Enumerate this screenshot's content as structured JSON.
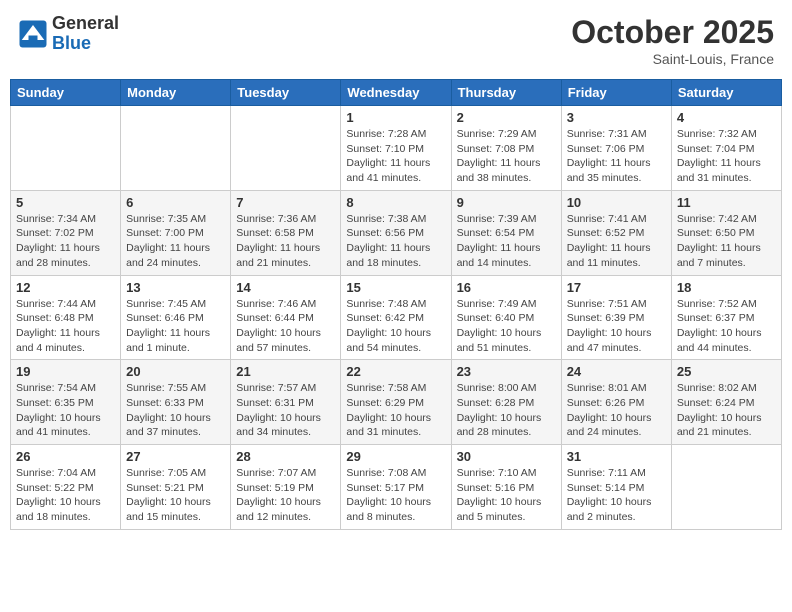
{
  "header": {
    "logo_general": "General",
    "logo_blue": "Blue",
    "month_title": "October 2025",
    "location": "Saint-Louis, France"
  },
  "days_of_week": [
    "Sunday",
    "Monday",
    "Tuesday",
    "Wednesday",
    "Thursday",
    "Friday",
    "Saturday"
  ],
  "weeks": [
    [
      {
        "day": "",
        "info": ""
      },
      {
        "day": "",
        "info": ""
      },
      {
        "day": "",
        "info": ""
      },
      {
        "day": "1",
        "info": "Sunrise: 7:28 AM\nSunset: 7:10 PM\nDaylight: 11 hours and 41 minutes."
      },
      {
        "day": "2",
        "info": "Sunrise: 7:29 AM\nSunset: 7:08 PM\nDaylight: 11 hours and 38 minutes."
      },
      {
        "day": "3",
        "info": "Sunrise: 7:31 AM\nSunset: 7:06 PM\nDaylight: 11 hours and 35 minutes."
      },
      {
        "day": "4",
        "info": "Sunrise: 7:32 AM\nSunset: 7:04 PM\nDaylight: 11 hours and 31 minutes."
      }
    ],
    [
      {
        "day": "5",
        "info": "Sunrise: 7:34 AM\nSunset: 7:02 PM\nDaylight: 11 hours and 28 minutes."
      },
      {
        "day": "6",
        "info": "Sunrise: 7:35 AM\nSunset: 7:00 PM\nDaylight: 11 hours and 24 minutes."
      },
      {
        "day": "7",
        "info": "Sunrise: 7:36 AM\nSunset: 6:58 PM\nDaylight: 11 hours and 21 minutes."
      },
      {
        "day": "8",
        "info": "Sunrise: 7:38 AM\nSunset: 6:56 PM\nDaylight: 11 hours and 18 minutes."
      },
      {
        "day": "9",
        "info": "Sunrise: 7:39 AM\nSunset: 6:54 PM\nDaylight: 11 hours and 14 minutes."
      },
      {
        "day": "10",
        "info": "Sunrise: 7:41 AM\nSunset: 6:52 PM\nDaylight: 11 hours and 11 minutes."
      },
      {
        "day": "11",
        "info": "Sunrise: 7:42 AM\nSunset: 6:50 PM\nDaylight: 11 hours and 7 minutes."
      }
    ],
    [
      {
        "day": "12",
        "info": "Sunrise: 7:44 AM\nSunset: 6:48 PM\nDaylight: 11 hours and 4 minutes."
      },
      {
        "day": "13",
        "info": "Sunrise: 7:45 AM\nSunset: 6:46 PM\nDaylight: 11 hours and 1 minute."
      },
      {
        "day": "14",
        "info": "Sunrise: 7:46 AM\nSunset: 6:44 PM\nDaylight: 10 hours and 57 minutes."
      },
      {
        "day": "15",
        "info": "Sunrise: 7:48 AM\nSunset: 6:42 PM\nDaylight: 10 hours and 54 minutes."
      },
      {
        "day": "16",
        "info": "Sunrise: 7:49 AM\nSunset: 6:40 PM\nDaylight: 10 hours and 51 minutes."
      },
      {
        "day": "17",
        "info": "Sunrise: 7:51 AM\nSunset: 6:39 PM\nDaylight: 10 hours and 47 minutes."
      },
      {
        "day": "18",
        "info": "Sunrise: 7:52 AM\nSunset: 6:37 PM\nDaylight: 10 hours and 44 minutes."
      }
    ],
    [
      {
        "day": "19",
        "info": "Sunrise: 7:54 AM\nSunset: 6:35 PM\nDaylight: 10 hours and 41 minutes."
      },
      {
        "day": "20",
        "info": "Sunrise: 7:55 AM\nSunset: 6:33 PM\nDaylight: 10 hours and 37 minutes."
      },
      {
        "day": "21",
        "info": "Sunrise: 7:57 AM\nSunset: 6:31 PM\nDaylight: 10 hours and 34 minutes."
      },
      {
        "day": "22",
        "info": "Sunrise: 7:58 AM\nSunset: 6:29 PM\nDaylight: 10 hours and 31 minutes."
      },
      {
        "day": "23",
        "info": "Sunrise: 8:00 AM\nSunset: 6:28 PM\nDaylight: 10 hours and 28 minutes."
      },
      {
        "day": "24",
        "info": "Sunrise: 8:01 AM\nSunset: 6:26 PM\nDaylight: 10 hours and 24 minutes."
      },
      {
        "day": "25",
        "info": "Sunrise: 8:02 AM\nSunset: 6:24 PM\nDaylight: 10 hours and 21 minutes."
      }
    ],
    [
      {
        "day": "26",
        "info": "Sunrise: 7:04 AM\nSunset: 5:22 PM\nDaylight: 10 hours and 18 minutes."
      },
      {
        "day": "27",
        "info": "Sunrise: 7:05 AM\nSunset: 5:21 PM\nDaylight: 10 hours and 15 minutes."
      },
      {
        "day": "28",
        "info": "Sunrise: 7:07 AM\nSunset: 5:19 PM\nDaylight: 10 hours and 12 minutes."
      },
      {
        "day": "29",
        "info": "Sunrise: 7:08 AM\nSunset: 5:17 PM\nDaylight: 10 hours and 8 minutes."
      },
      {
        "day": "30",
        "info": "Sunrise: 7:10 AM\nSunset: 5:16 PM\nDaylight: 10 hours and 5 minutes."
      },
      {
        "day": "31",
        "info": "Sunrise: 7:11 AM\nSunset: 5:14 PM\nDaylight: 10 hours and 2 minutes."
      },
      {
        "day": "",
        "info": ""
      }
    ]
  ]
}
